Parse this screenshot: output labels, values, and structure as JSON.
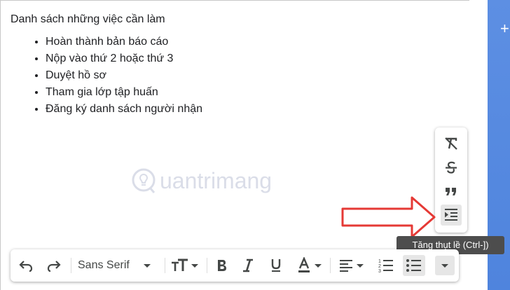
{
  "editor": {
    "intro": "Danh sách những việc cần làm",
    "items": [
      "Hoàn thành bản báo cáo",
      "Nộp vào thứ 2 hoặc thứ 3",
      "Duyệt hồ sơ",
      "Tham gia lớp tập huấn",
      "Đăng ký danh sách người nhận"
    ]
  },
  "watermark": {
    "text": "uantrimang",
    "icon": "lightbulb-q-logo"
  },
  "format_popup": {
    "icons": [
      "remove-formatting-icon",
      "strikethrough-icon",
      "quote-icon",
      "indent-more-icon"
    ]
  },
  "tooltip": {
    "text": "Tăng thụt lề (Ctrl-])"
  },
  "toolbar": {
    "font_name": "Sans Serif",
    "icons": [
      "undo-icon",
      "redo-icon",
      "font-size-icon",
      "bold-icon",
      "italic-icon",
      "underline-icon",
      "text-color-icon",
      "align-icon",
      "numbered-list-icon",
      "bulleted-list-icon",
      "more-formatting-icon"
    ]
  },
  "right_panel": {
    "plus_label": "+"
  },
  "colors": {
    "accent_blue": "#4f84dd",
    "arrow_red": "#e53935",
    "tooltip_bg": "#4d4d4d"
  }
}
